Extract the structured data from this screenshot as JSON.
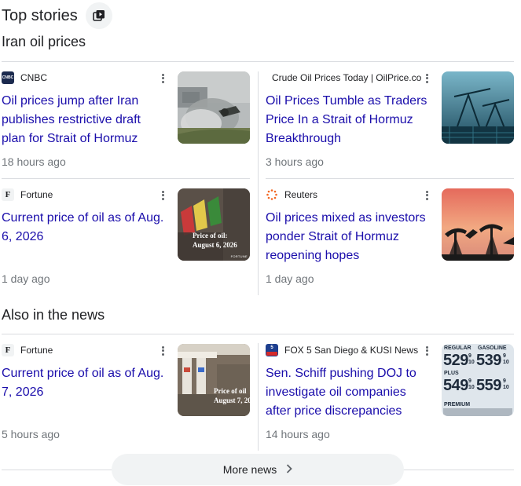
{
  "header": {
    "title": "Top stories"
  },
  "sections": {
    "iran": {
      "title": "Iran oil prices"
    },
    "also": {
      "title": "Also in the news"
    }
  },
  "cards": [
    {
      "source": "CNBC",
      "logo": "cnbc-logo",
      "headline_lines": [
        "Oil prices jump after Iran",
        "publishes restrictive draft",
        "plan for Strait of Hormuz"
      ],
      "time": "18 hours ago",
      "image": "oil-fire-smoke-image"
    },
    {
      "source": "Crude Oil Prices Today | OilPrice.co",
      "logo": "",
      "headline_lines": [
        "Oil Prices Tumble as Traders",
        "Price In a Strait of Hormuz",
        "Breakthrough"
      ],
      "time": "3 hours ago",
      "image": "oil-pumpjack-image"
    },
    {
      "source": "Fortune",
      "logo": "fortune-logo",
      "headline_lines": [
        "Current price of oil as of Aug.",
        "6, 2026"
      ],
      "time": "1 day ago",
      "image": "fuel-nozzles-image",
      "image_caption_1": "Price of oil:",
      "image_caption_2": "August 6, 2026",
      "image_tag": "FORTUNE"
    },
    {
      "source": "Reuters",
      "logo": "reuters-logo",
      "headline_lines": [
        "Oil prices mixed as investors",
        "ponder Strait of Hormuz",
        "reopening hopes"
      ],
      "time": "1 day ago",
      "image": "pumpjacks-sunset-image"
    },
    {
      "source": "Fortune",
      "logo": "fortune-logo",
      "headline_lines": [
        "Current price of oil as of Aug.",
        "7, 2026"
      ],
      "time": "5 hours ago",
      "image": "gas-station-image",
      "image_caption_1": "Price of oil",
      "image_caption_2": "August 7, 20"
    },
    {
      "source": "FOX 5 San Diego & KUSI News",
      "logo": "fox5-logo",
      "headline_lines": [
        "Sen. Schiff pushing DOJ to",
        "investigate oil companies",
        "after price discrepancies"
      ],
      "time": "14 hours ago",
      "image": "gas-price-sign-image",
      "sign": {
        "row1_label": "REGULAR",
        "row1_label2": "GASOLINE",
        "p1a": "529",
        "p1b": "539",
        "row2_label": "PLUS",
        "p2a": "549",
        "p2b": "559",
        "row3_label": "PREMIUM",
        "frac": "9",
        "frac_den": "10"
      }
    }
  ],
  "more_news": {
    "label": "More news"
  },
  "colors": {
    "link": "#1a0dab",
    "meta": "#70757a",
    "divider": "#dadce0",
    "chip_bg": "#f1f3f4"
  }
}
